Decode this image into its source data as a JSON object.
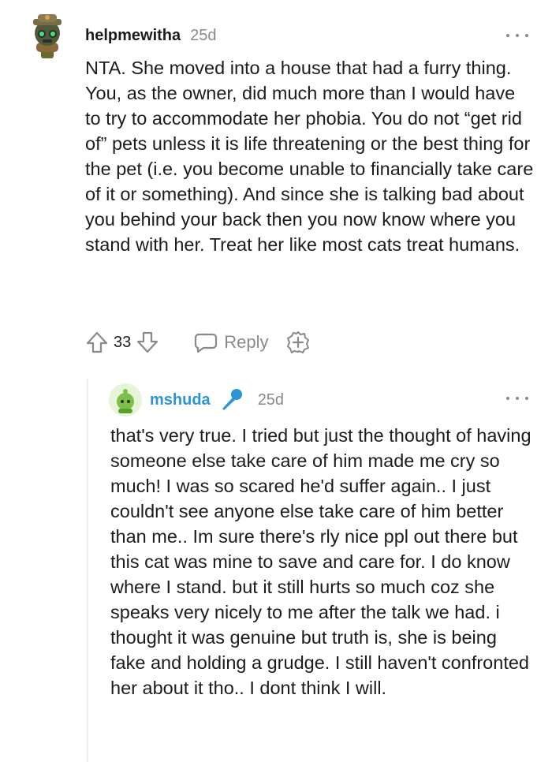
{
  "comment": {
    "username": "helpmewitha",
    "timestamp": "25d",
    "body": "NTA. She moved into a house that had a furry thing. You, as the owner, did much more than I would have to try to accommodate her phobia. You do not “get rid of” pets unless it is life threatening or the best thing for the pet (i.e. you become unable to financially take care of it or something). And since she is talking bad about you behind your back then you now know where you stand with her. Treat her like most cats treat humans.",
    "vote_count": "33",
    "reply_label": "Reply"
  },
  "reply": {
    "username": "mshuda",
    "timestamp": "25d",
    "body": "that's very true. I tried but just the thought of having someone else take care of him made me cry so much! I was so scared he'd suffer again.. I just couldn't see anyone else take care of him better than me.. Im sure there's rly nice ppl out there but this cat was mine to save and care for. I do know where I stand. but it still hurts so much coz she speaks very nicely to me after the talk we had. i thought it was genuine but truth is, she is being fake and holding a grudge. I still haven't confronted her about it tho.. I dont think I will."
  },
  "icons": {
    "avatar_1": "snoo-avatar-helmet",
    "avatar_2": "snoo-avatar-green",
    "op_badge": "microphone-icon",
    "more": "ellipsis-icon",
    "upvote": "upvote-arrow-icon",
    "downvote": "downvote-arrow-icon",
    "reply": "speech-bubble-icon",
    "award": "award-plus-icon"
  },
  "colors": {
    "username_op": "#2b95d6",
    "muted": "#878a8c",
    "text": "#1c1c1c"
  }
}
